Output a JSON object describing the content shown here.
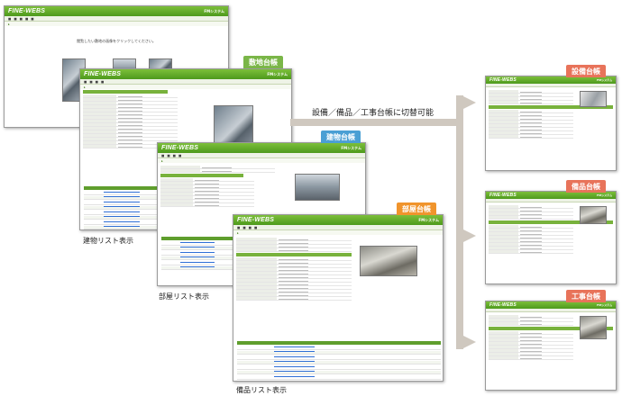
{
  "app": {
    "logo": "FINE-WEBS",
    "system_name": "FMシステム"
  },
  "message": "閲覧したい敷地の画像をクリックしてください。",
  "labels": {
    "site_ledger": "敷地台帳",
    "building_ledger": "建物台帳",
    "room_ledger": "部屋台帳",
    "equipment_ledger": "設備台帳",
    "fixture_ledger": "備品台帳",
    "construction_ledger": "工事台帳",
    "switch_caption": "設備／備品／工事台帳に切替可能",
    "building_list": "建物リスト表示",
    "room_list": "部屋リスト表示",
    "fixture_list": "備品リスト表示"
  },
  "colors": {
    "header_green": "#5ba524",
    "tag_green": "#7ab648",
    "tag_blue": "#4a9fd4",
    "tag_orange": "#f0942c",
    "tag_red": "#e8735a",
    "arrow_gray": "#c9c1b8"
  }
}
